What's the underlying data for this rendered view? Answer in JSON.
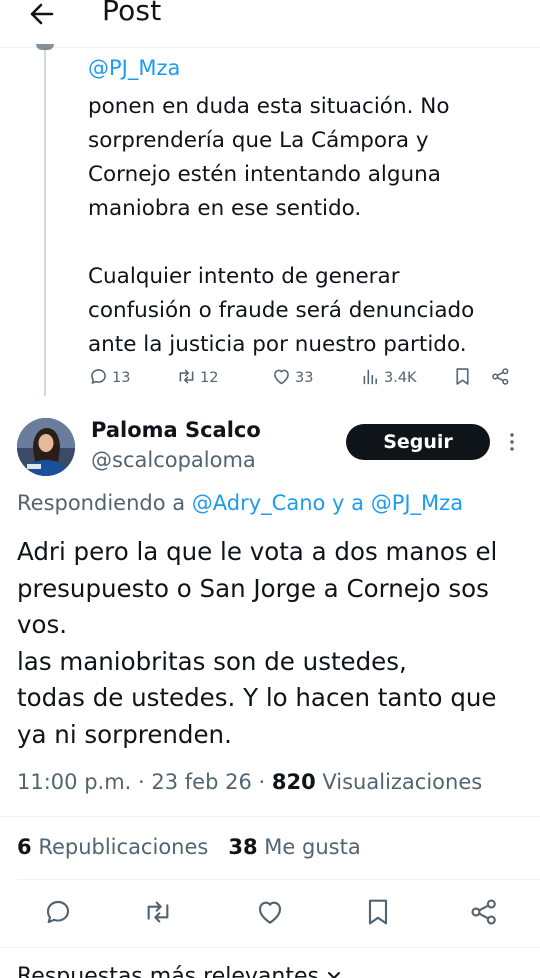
{
  "header": {
    "title": "Post"
  },
  "previous_post": {
    "handle": "@PJ_Mza",
    "text": "ponen en duda esta situación. No\nsorprendería que La Cámpora y\nCornejo estén intentando alguna\nmaniobra en ese sentido.\n\nCualquier intento de generar\nconfusión o fraude será denunciado\nante la justicia por nuestro partido.",
    "replies": "13",
    "reposts": "12",
    "likes": "33",
    "views": "3.4K"
  },
  "post": {
    "author_name": "Paloma Scalco",
    "author_handle": "@scalcopaloma",
    "follow_label": "Seguir",
    "replying_prefix": "Respondiendo a ",
    "replying_mention_1": "@Adry_Cano",
    "replying_conj": " y a ",
    "replying_mention_2": "@PJ_Mza",
    "text": "Adri pero la que le vota  a dos manos el\npresupuesto o San Jorge a Cornejo sos\nvos.\nlas maniobritas son de ustedes,\ntodas de ustedes. Y lo hacen tanto que\nya ni sorprenden.",
    "time": "11:00 p.m.",
    "date": "23 feb 26",
    "views_count": "820",
    "views_label": "Visualizaciones",
    "reposts_count": "6",
    "reposts_label": "Republicaciones",
    "likes_count": "38",
    "likes_label": "Me gusta"
  },
  "footer": {
    "relevant_replies": "Respuestas más relevantes"
  },
  "icons": {
    "back": "arrow-left-icon",
    "reply": "speech-bubble-icon",
    "repost": "repost-arrows-icon",
    "like": "heart-icon",
    "views": "bar-chart-icon",
    "bookmark": "bookmark-icon",
    "share": "share-nodes-icon",
    "more": "vertical-dots-icon",
    "chevron": "chevron-down-icon"
  },
  "colors": {
    "accent": "#1d9bf0",
    "text": "#0f1419",
    "muted": "#536471",
    "button": "#0f1419"
  }
}
